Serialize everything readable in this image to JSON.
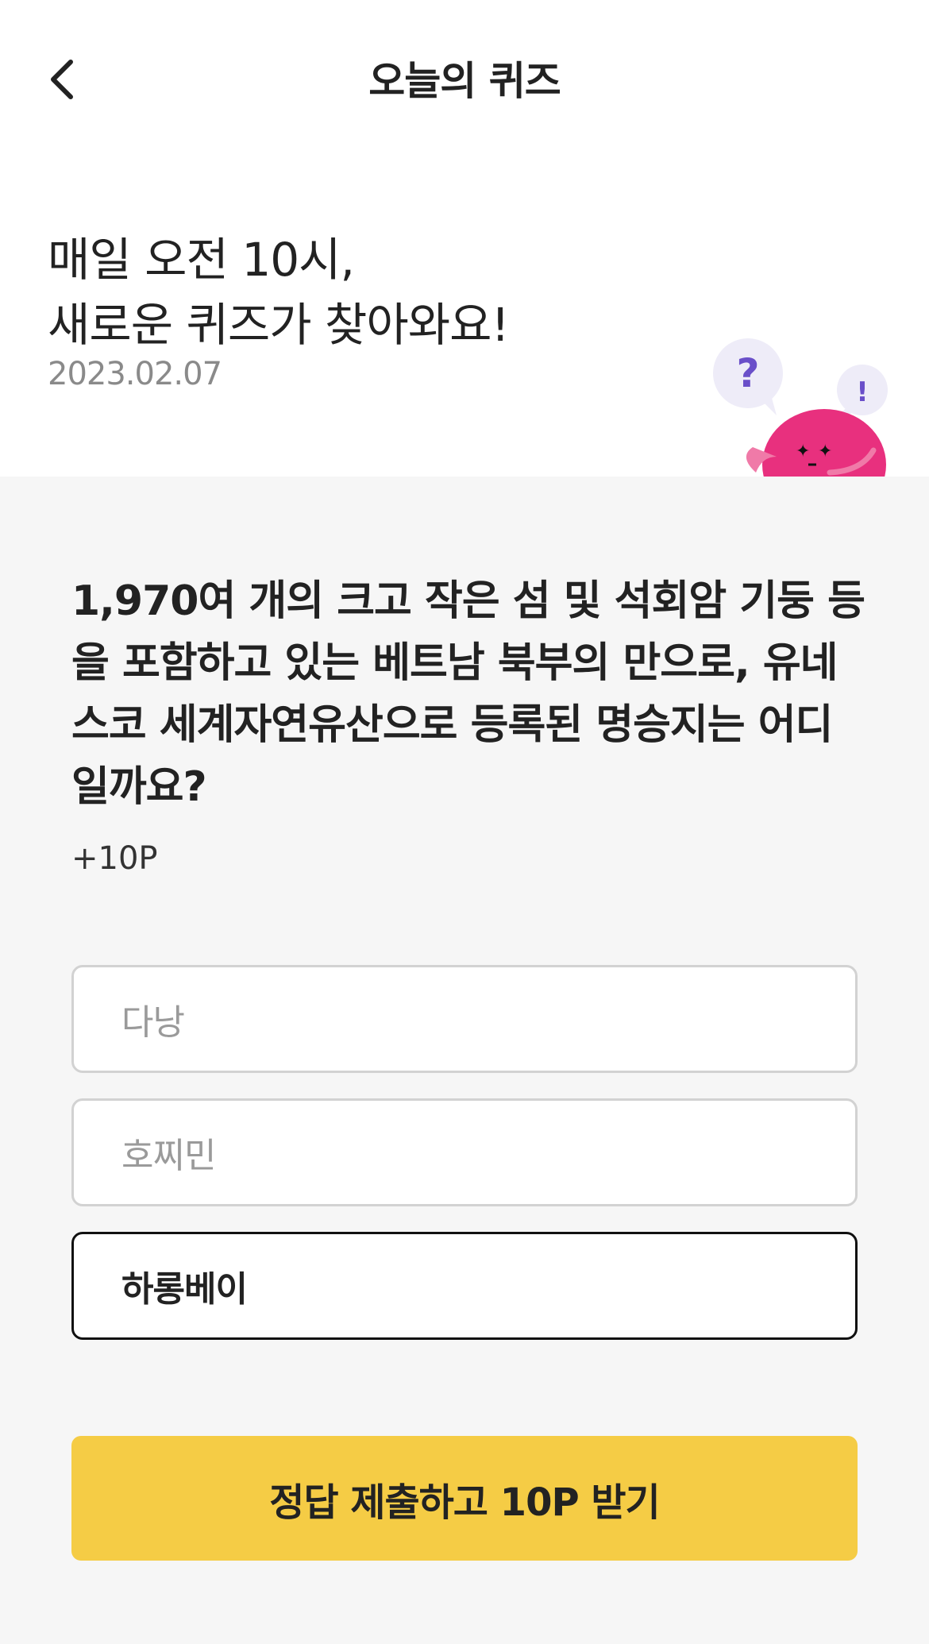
{
  "header": {
    "back_icon": "chevron-left-icon",
    "title": "오늘의 퀴즈"
  },
  "intro": {
    "line1": "매일 오전 10시,",
    "line2": "새로운 퀴즈가 찾아와요!",
    "date": "2023.02.07"
  },
  "mascot": {
    "bubble_question": "?",
    "bubble_exclaim": "!",
    "body_color": "#e8307e"
  },
  "quiz": {
    "question": "1,970여 개의 크고 작은 섬 및 석회암 기둥 등을 포함하고 있는 베트남 북부의 만으로, 유네스코 세계자연유산으로 등록된 명승지는 어디일까요?",
    "points": "+10P",
    "options": [
      {
        "label": "다낭",
        "selected": false
      },
      {
        "label": "호찌민",
        "selected": false
      },
      {
        "label": "하롱베이",
        "selected": true
      }
    ],
    "submit_label": "정답 제출하고 10P 받기"
  },
  "colors": {
    "accent": "#f5cc45",
    "section_bg": "#f6f6f6",
    "selected_border": "#111111"
  }
}
